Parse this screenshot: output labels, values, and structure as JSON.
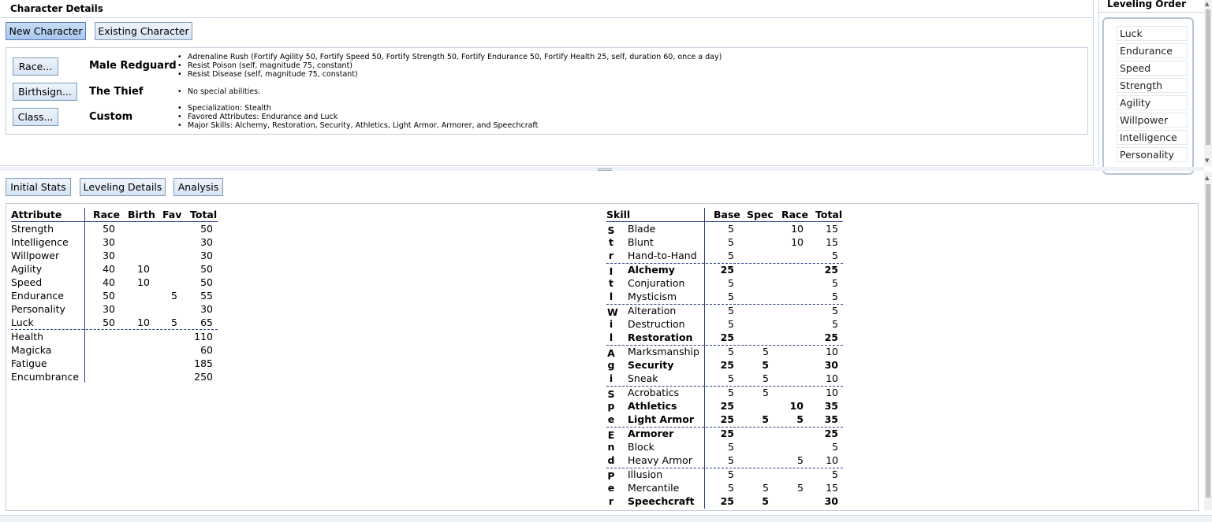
{
  "character_details": {
    "title": "Character Details",
    "new_character": "New Character",
    "existing_character": "Existing Character",
    "race_button": "Race...",
    "race_name": "Male Redguard",
    "race_abilities": [
      "Adrenaline Rush (Fortify Agility 50, Fortify Speed 50, Fortify Strength 50, Fortify Endurance 50, Fortify Health 25, self, duration 60, once a day)",
      "Resist Poison (self, magnitude 75, constant)",
      "Resist Disease (self, magnitude 75, constant)"
    ],
    "birthsign_button": "Birthsign...",
    "birthsign_name": "The Thief",
    "birthsign_abilities": [
      "No special abilities."
    ],
    "class_button": "Class...",
    "class_name": "Custom",
    "class_details": [
      "Specialization: Stealth",
      "Favored Attributes: Endurance and Luck",
      "Major Skills: Alchemy, Restoration, Security, Athletics, Light Armor, Armorer, and Speechcraft"
    ]
  },
  "leveling_order": {
    "title": "Leveling Order",
    "items": [
      "Luck",
      "Endurance",
      "Speed",
      "Strength",
      "Agility",
      "Willpower",
      "Intelligence",
      "Personality"
    ]
  },
  "tabs": [
    "Initial Stats",
    "Leveling Details",
    "Analysis"
  ],
  "attributes": {
    "headers": [
      "Attribute",
      "Race",
      "Birth",
      "Fav",
      "Total"
    ],
    "rows": [
      [
        "Strength",
        "50",
        "",
        "",
        "50"
      ],
      [
        "Intelligence",
        "30",
        "",
        "",
        "30"
      ],
      [
        "Willpower",
        "30",
        "",
        "",
        "30"
      ],
      [
        "Agility",
        "40",
        "10",
        "",
        "50"
      ],
      [
        "Speed",
        "40",
        "10",
        "",
        "50"
      ],
      [
        "Endurance",
        "50",
        "",
        "5",
        "55"
      ],
      [
        "Personality",
        "30",
        "",
        "",
        "30"
      ],
      [
        "Luck",
        "50",
        "10",
        "5",
        "65"
      ]
    ],
    "derived": [
      [
        "Health",
        "110"
      ],
      [
        "Magicka",
        "60"
      ],
      [
        "Fatigue",
        "185"
      ],
      [
        "Encumbrance",
        "250"
      ]
    ]
  },
  "skills": {
    "headers": [
      "Skill",
      "Base",
      "Spec",
      "Race",
      "Total"
    ],
    "groups": [
      {
        "letters": [
          "S",
          "t",
          "r"
        ],
        "rows": [
          {
            "name": "Blade",
            "base": "5",
            "spec": "",
            "race": "10",
            "total": "15",
            "major": false
          },
          {
            "name": "Blunt",
            "base": "5",
            "spec": "",
            "race": "10",
            "total": "15",
            "major": false
          },
          {
            "name": "Hand-to-Hand",
            "base": "5",
            "spec": "",
            "race": "",
            "total": "5",
            "major": false
          }
        ]
      },
      {
        "letters": [
          "I",
          "t",
          "l"
        ],
        "rows": [
          {
            "name": "Alchemy",
            "base": "25",
            "spec": "",
            "race": "",
            "total": "25",
            "major": true
          },
          {
            "name": "Conjuration",
            "base": "5",
            "spec": "",
            "race": "",
            "total": "5",
            "major": false
          },
          {
            "name": "Mysticism",
            "base": "5",
            "spec": "",
            "race": "",
            "total": "5",
            "major": false
          }
        ]
      },
      {
        "letters": [
          "W",
          "i",
          "l"
        ],
        "rows": [
          {
            "name": "Alteration",
            "base": "5",
            "spec": "",
            "race": "",
            "total": "5",
            "major": false
          },
          {
            "name": "Destruction",
            "base": "5",
            "spec": "",
            "race": "",
            "total": "5",
            "major": false
          },
          {
            "name": "Restoration",
            "base": "25",
            "spec": "",
            "race": "",
            "total": "25",
            "major": true
          }
        ]
      },
      {
        "letters": [
          "A",
          "g",
          "i"
        ],
        "rows": [
          {
            "name": "Marksmanship",
            "base": "5",
            "spec": "5",
            "race": "",
            "total": "10",
            "major": false
          },
          {
            "name": "Security",
            "base": "25",
            "spec": "5",
            "race": "",
            "total": "30",
            "major": true
          },
          {
            "name": "Sneak",
            "base": "5",
            "spec": "5",
            "race": "",
            "total": "10",
            "major": false
          }
        ]
      },
      {
        "letters": [
          "S",
          "p",
          "e"
        ],
        "rows": [
          {
            "name": "Acrobatics",
            "base": "5",
            "spec": "5",
            "race": "",
            "total": "10",
            "major": false
          },
          {
            "name": "Athletics",
            "base": "25",
            "spec": "",
            "race": "10",
            "total": "35",
            "major": true
          },
          {
            "name": "Light Armor",
            "base": "25",
            "spec": "5",
            "race": "5",
            "total": "35",
            "major": true
          }
        ]
      },
      {
        "letters": [
          "E",
          "n",
          "d"
        ],
        "rows": [
          {
            "name": "Armorer",
            "base": "25",
            "spec": "",
            "race": "",
            "total": "25",
            "major": true
          },
          {
            "name": "Block",
            "base": "5",
            "spec": "",
            "race": "",
            "total": "5",
            "major": false
          },
          {
            "name": "Heavy Armor",
            "base": "5",
            "spec": "",
            "race": "5",
            "total": "10",
            "major": false
          }
        ]
      },
      {
        "letters": [
          "P",
          "e",
          "r"
        ],
        "rows": [
          {
            "name": "Illusion",
            "base": "5",
            "spec": "",
            "race": "",
            "total": "5",
            "major": false
          },
          {
            "name": "Mercantile",
            "base": "5",
            "spec": "5",
            "race": "5",
            "total": "15",
            "major": false
          },
          {
            "name": "Speechcraft",
            "base": "25",
            "spec": "5",
            "race": "",
            "total": "30",
            "major": true
          }
        ]
      }
    ]
  }
}
